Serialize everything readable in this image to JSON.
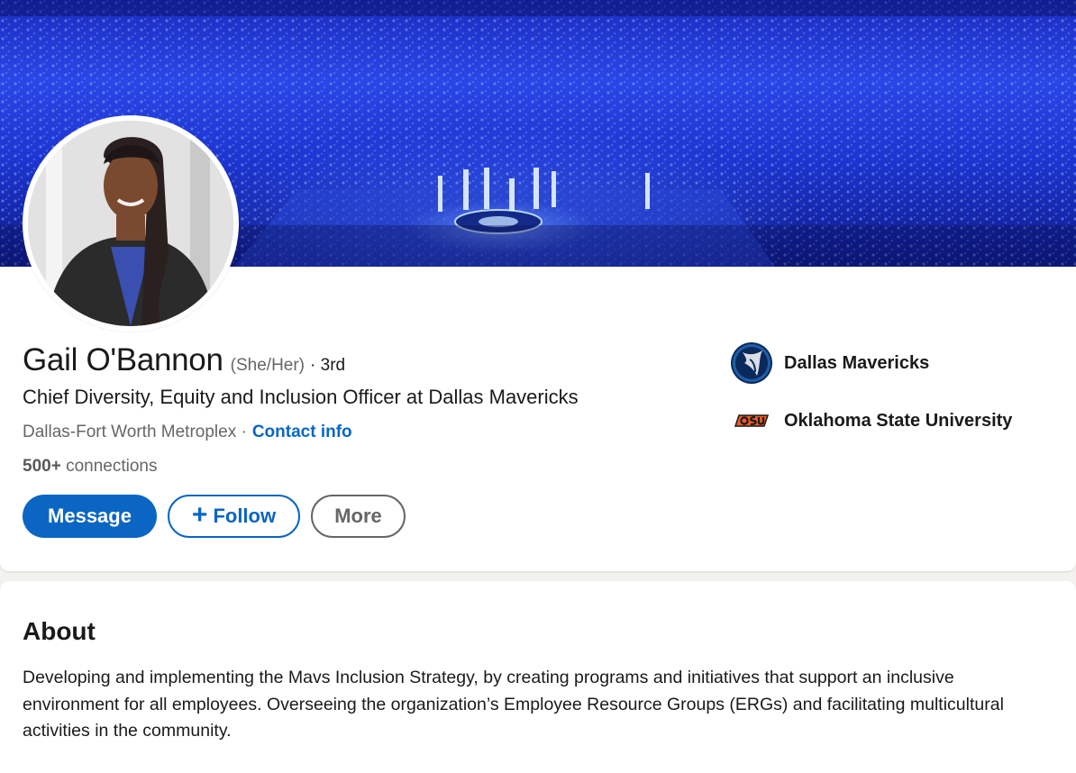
{
  "profile": {
    "name": "Gail O'Bannon",
    "pronouns": "(She/Her)",
    "degree": "· 3rd",
    "headline": "Chief Diversity, Equity and Inclusion Officer at Dallas Mavericks",
    "location": "Dallas-Fort Worth Metroplex ·",
    "contact_label": "Contact info",
    "connections_count": "500+",
    "connections_label": "connections"
  },
  "actions": {
    "message_label": "Message",
    "follow_icon": "+",
    "follow_label": "Follow",
    "more_label": "More"
  },
  "organizations": [
    {
      "name": "Dallas Mavericks",
      "icon": "mavericks-logo-icon"
    },
    {
      "name": "Oklahoma State University",
      "icon": "osu-logo-icon"
    }
  ],
  "about": {
    "title": "About",
    "text": "Developing and implementing the Mavs Inclusion Strategy, by creating programs and initiatives that support an inclusive environment for all employees. Overseeing the organization’s Employee Resource Groups (ERGs) and facilitating multicultural activities in the community."
  },
  "colors": {
    "accent": "#0a66c2",
    "banner_blue": "#2a46e6",
    "osu_orange": "#f05a22"
  }
}
